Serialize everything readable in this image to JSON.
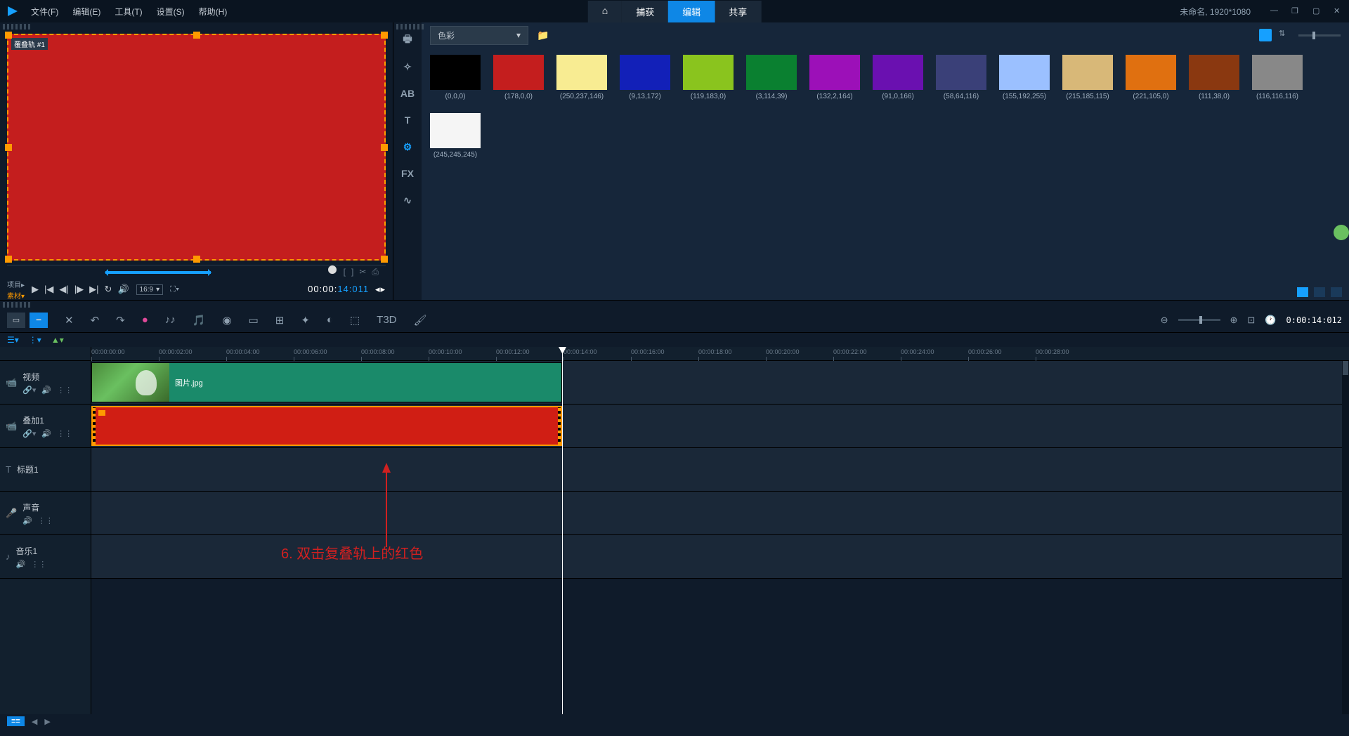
{
  "menu": {
    "file": "文件(F)",
    "edit": "编辑(E)",
    "tools": "工具(T)",
    "settings": "设置(S)",
    "help": "帮助(H)"
  },
  "main_tabs": {
    "home": "⌂",
    "capture": "捕获",
    "edit": "编辑",
    "share": "共享"
  },
  "doc_title": "未命名, 1920*1080",
  "preview": {
    "overlay_label": "覆叠轨 #1",
    "project_label": "项目▸",
    "material_label": "素材▾",
    "aspect": "16:9",
    "timecode_prefix": "00:00:",
    "timecode_frames": "14:011"
  },
  "library": {
    "dropdown": "色彩",
    "swatches": [
      {
        "label": "(0,0,0)",
        "color": "#000000"
      },
      {
        "label": "(178,0,0)",
        "color": "#c41e1e"
      },
      {
        "label": "(250,237,146)",
        "color": "#f8ec92"
      },
      {
        "label": "(9,13,172)",
        "color": "#1220b8"
      },
      {
        "label": "(119,183,0)",
        "color": "#8ac41e"
      },
      {
        "label": "(3,114,39)",
        "color": "#0a8030"
      },
      {
        "label": "(132,2,164)",
        "color": "#9c10b8"
      },
      {
        "label": "(91,0,166)",
        "color": "#6a10b0"
      },
      {
        "label": "(58,64,116)",
        "color": "#3a4078"
      },
      {
        "label": "(155,192,255)",
        "color": "#9bc0ff"
      },
      {
        "label": "(215,185,115)",
        "color": "#d8b878"
      },
      {
        "label": "(221,105,0)",
        "color": "#e07010"
      },
      {
        "label": "(111,38,0)",
        "color": "#8a3810"
      },
      {
        "label": "(116,116,116)",
        "color": "#888888"
      },
      {
        "label": "(245,245,245)",
        "color": "#f5f5f5"
      }
    ]
  },
  "timeline": {
    "time_display": "0:00:14:012",
    "ruler": [
      "00:00:00:00",
      "00:00:02:00",
      "00:00:04:00",
      "00:00:06:00",
      "00:00:08:00",
      "00:00:10:00",
      "00:00:12:00",
      "00:00:14:00",
      "00:00:16:00",
      "00:00:18:00",
      "00:00:20:00",
      "00:00:22:00",
      "00:00:24:00",
      "00:00:26:00",
      "00:00:28:00"
    ],
    "tracks": {
      "video": "视频",
      "overlay": "叠加1",
      "title": "标题1",
      "voice": "声音",
      "music": "音乐1"
    },
    "video_clip_name": "图片.jpg"
  },
  "annotation": "6. 双击复叠轨上的红色"
}
